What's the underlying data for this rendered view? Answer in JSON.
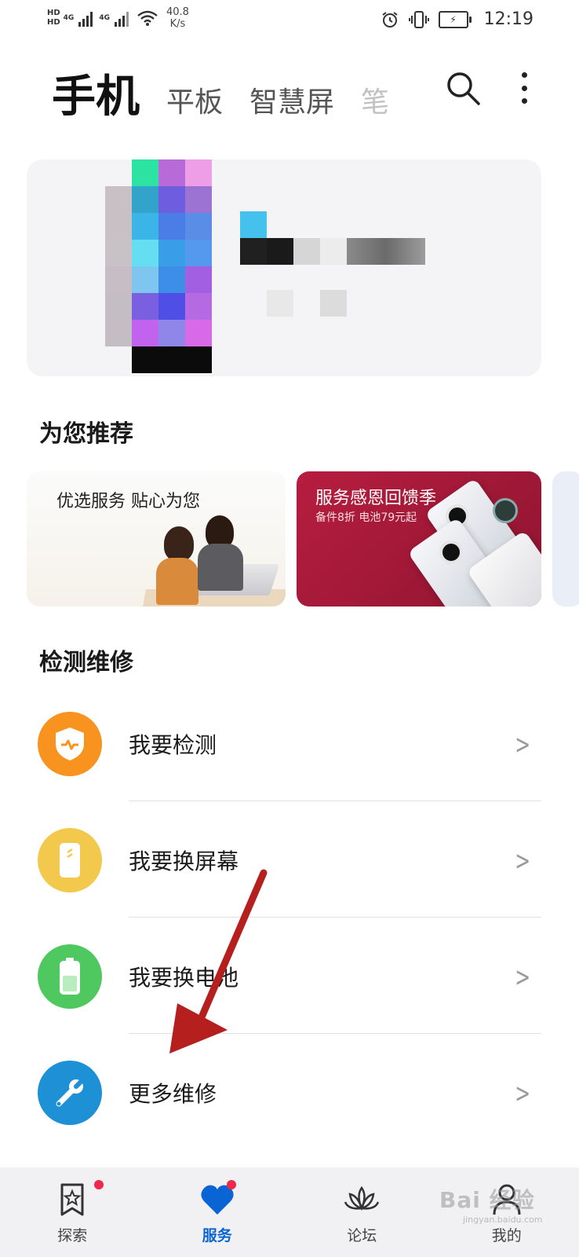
{
  "status_bar": {
    "hd1": "HD",
    "hd2": "HD",
    "net1": "4G",
    "net2": "4G",
    "speed_value": "40.8",
    "speed_unit": "K/s",
    "time": "12:19"
  },
  "header": {
    "tabs": [
      {
        "label": "手机"
      },
      {
        "label": "平板"
      },
      {
        "label": "智慧屏"
      },
      {
        "label": "笔"
      }
    ]
  },
  "recommend": {
    "title": "为您推荐",
    "banners": [
      {
        "text": "优选服务 贴心为您"
      },
      {
        "title": "服务感恩回馈季",
        "subtitle": "备件8折 电池79元起"
      },
      {
        "text": ""
      }
    ]
  },
  "repair": {
    "title": "检测维修",
    "items": [
      {
        "label": "我要检测",
        "icon": "shield-icon",
        "color": "#f7931e"
      },
      {
        "label": "我要换屏幕",
        "icon": "phone-screen-icon",
        "color": "#f2c94c"
      },
      {
        "label": "我要换电池",
        "icon": "battery-icon",
        "color": "#4fc860"
      },
      {
        "label": "更多维修",
        "icon": "wrench-icon",
        "color": "#1e90d6"
      }
    ]
  },
  "bottom_nav": {
    "items": [
      {
        "label": "探索",
        "icon": "explore-icon",
        "active": false
      },
      {
        "label": "服务",
        "icon": "heart-icon",
        "active": true
      },
      {
        "label": "论坛",
        "icon": "lotus-icon",
        "active": false
      },
      {
        "label": "我的",
        "icon": "user-icon",
        "active": false
      }
    ]
  },
  "watermark": {
    "text": "Bai 经验",
    "sub": "jingyan.baidu.com"
  },
  "colors": {
    "accent": "#0a64d4",
    "badge": "#f0264a",
    "arrow": "#b5201f"
  }
}
